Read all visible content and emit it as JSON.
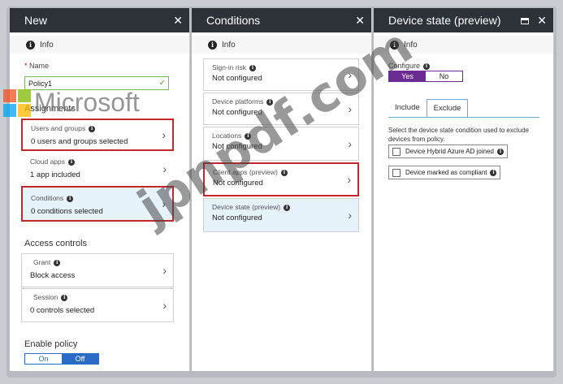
{
  "blade_new": {
    "title": "New",
    "info": "Info",
    "name_label": "Name",
    "name_value": "Policy1",
    "assignments_title": "Assignments",
    "users_groups": {
      "title": "Users and groups",
      "value": "0 users and groups selected"
    },
    "cloud_apps": {
      "title": "Cloud apps",
      "value": "1 app included"
    },
    "conditions": {
      "title": "Conditions",
      "value": "0  conditions  selected"
    },
    "access_controls_title": "Access controls",
    "grant": {
      "title": "Grant",
      "value": "Block access"
    },
    "session": {
      "title": "Session",
      "value": "0 controls selected"
    },
    "enable_policy_title": "Enable policy",
    "enable_on": "On",
    "enable_off": "Off",
    "enable_selected": "Off"
  },
  "blade_conditions": {
    "title": "Conditions",
    "info": "Info",
    "items": [
      {
        "title": "Sign-in risk",
        "value": "Not configured"
      },
      {
        "title": "Device platforms",
        "value": "Not configured"
      },
      {
        "title": "Locations",
        "value": "Not configured"
      },
      {
        "title": "Client apps (preview)",
        "value": "Not configured"
      },
      {
        "title": "Device state (preview)",
        "value": "Not configured"
      }
    ]
  },
  "blade_device_state": {
    "title": "Device state (preview)",
    "info": "Info",
    "configure_label": "Configure",
    "configure_yes": "Yes",
    "configure_no": "No",
    "tabs": [
      "Include",
      "Exclude"
    ],
    "active_tab": "Exclude",
    "description": "Select the device state condition used to exclude devices from policy.",
    "options": [
      "Device Hybrid Azure AD joined",
      "Device marked as compliant"
    ]
  },
  "watermarks": {
    "logo_text": "Microsoft",
    "site_text": "jpnpdf.com"
  },
  "colors": {
    "header_bg": "#2d3238",
    "highlight": "#c1272d",
    "toggle_blue": "#2a6cc5",
    "toggle_purple": "#6a2c91",
    "selected_bg": "#e7f3fb"
  }
}
